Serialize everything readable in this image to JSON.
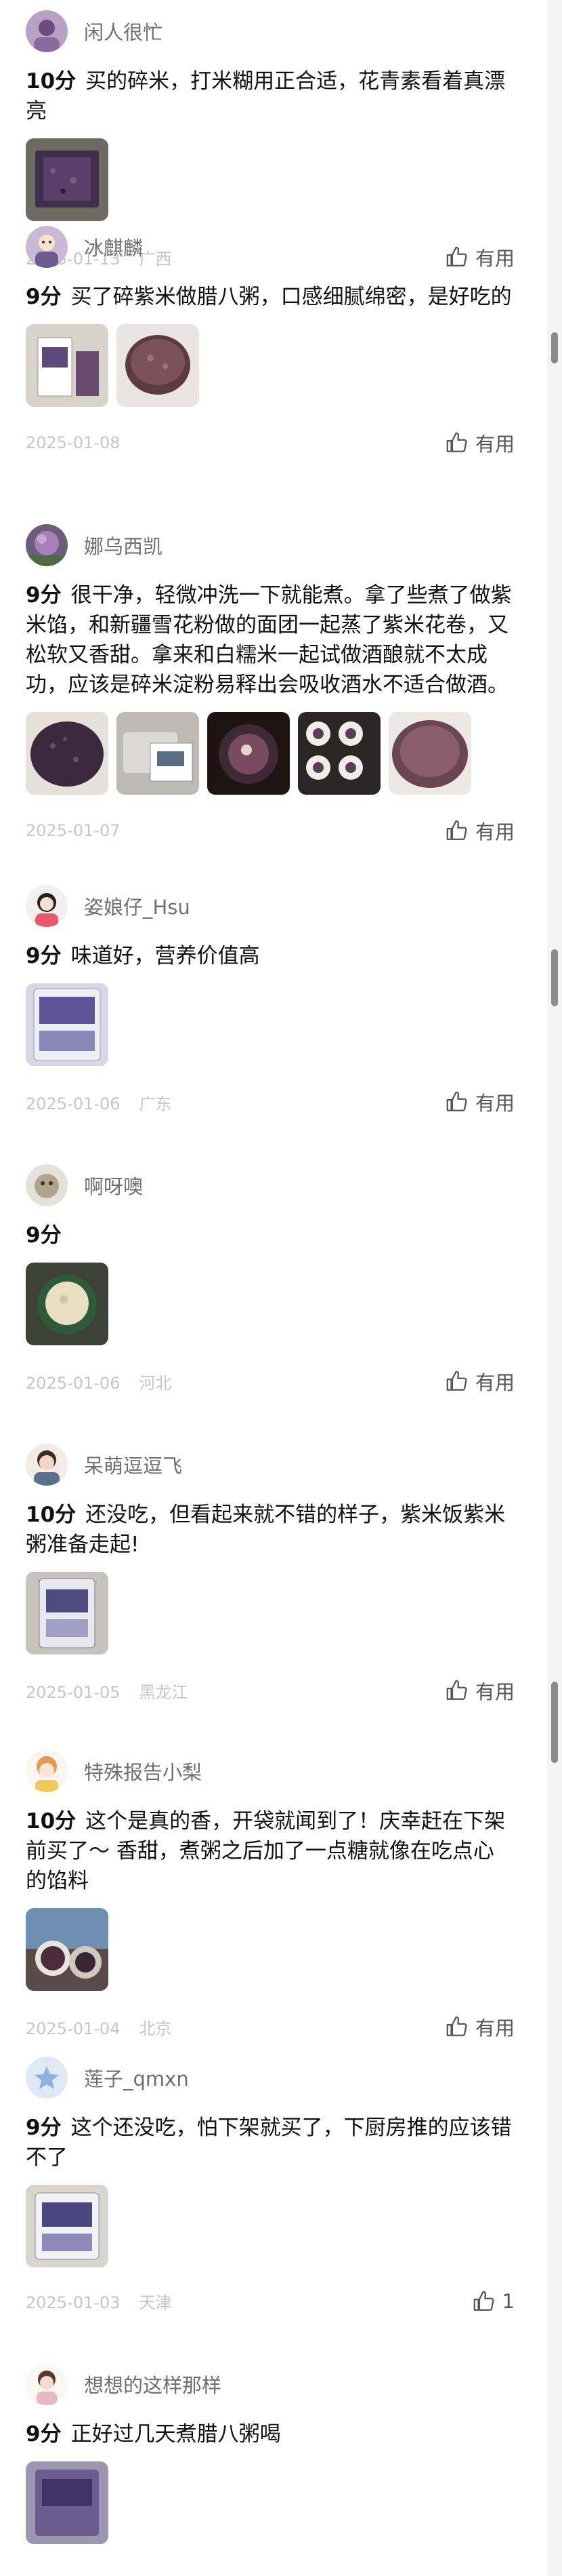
{
  "useful_label": "有用",
  "reviews": [
    {
      "username": "闲人很忙",
      "score": "10分",
      "text": "买的碎米，打米糊用正合适，花青素看着真漂亮",
      "date": "2025-01-13",
      "location": "广西",
      "useful": "有用",
      "images": 1
    },
    {
      "username": "冰麒麟",
      "score": "9分",
      "text": "买了碎紫米做腊八粥，口感细腻绵密，是好吃的",
      "date": "2025-01-08",
      "location": "",
      "useful": "有用",
      "images": 2
    },
    {
      "username": "娜乌西凯",
      "score": "9分",
      "text": "很干净，轻微冲洗一下就能煮。拿了些煮了做紫米馅，和新疆雪花粉做的面团一起蒸了紫米花卷，又松软又香甜。拿来和白糯米一起试做酒酿就不太成功，应该是碎米淀粉易释出会吸收酒水不适合做酒。",
      "date": "2025-01-07",
      "location": "",
      "useful": "有用",
      "images": 5
    },
    {
      "username": "姿娘仔_Hsu",
      "score": "9分",
      "text": "味道好，营养价值高",
      "date": "2025-01-06",
      "location": "广东",
      "useful": "有用",
      "images": 1
    },
    {
      "username": "啊呀噢",
      "score": "9分",
      "text": "",
      "date": "2025-01-06",
      "location": "河北",
      "useful": "有用",
      "images": 1
    },
    {
      "username": "呆萌逗逗飞",
      "score": "10分",
      "text": "还没吃，但看起来就不错的样子，紫米饭紫米粥准备走起!",
      "date": "2025-01-05",
      "location": "黑龙江",
      "useful": "有用",
      "images": 1
    },
    {
      "username": "特殊报告小梨",
      "score": "10分",
      "text": "这个是真的香，开袋就闻到了！庆幸赶在下架前买了～ 香甜，煮粥之后加了一点糖就像在吃点心的馅料",
      "date": "2025-01-04",
      "location": "北京",
      "useful": "有用",
      "images": 1
    },
    {
      "username": "莲子_qmxn",
      "score": "9分",
      "text": "这个还没吃，怕下架就买了，下厨房推的应该错不了",
      "date": "2025-01-03",
      "location": "天津",
      "useful": "1",
      "images": 1
    },
    {
      "username": "想想的这样那样",
      "score": "9分",
      "text": "正好过几天煮腊八粥喝",
      "date": "",
      "location": "",
      "useful": "",
      "images": 1
    }
  ],
  "colors": {
    "username": "#6f6f6f",
    "meta": "#c6c6c6",
    "body_text": "#111111",
    "rice_purple": "#4a2e52"
  }
}
